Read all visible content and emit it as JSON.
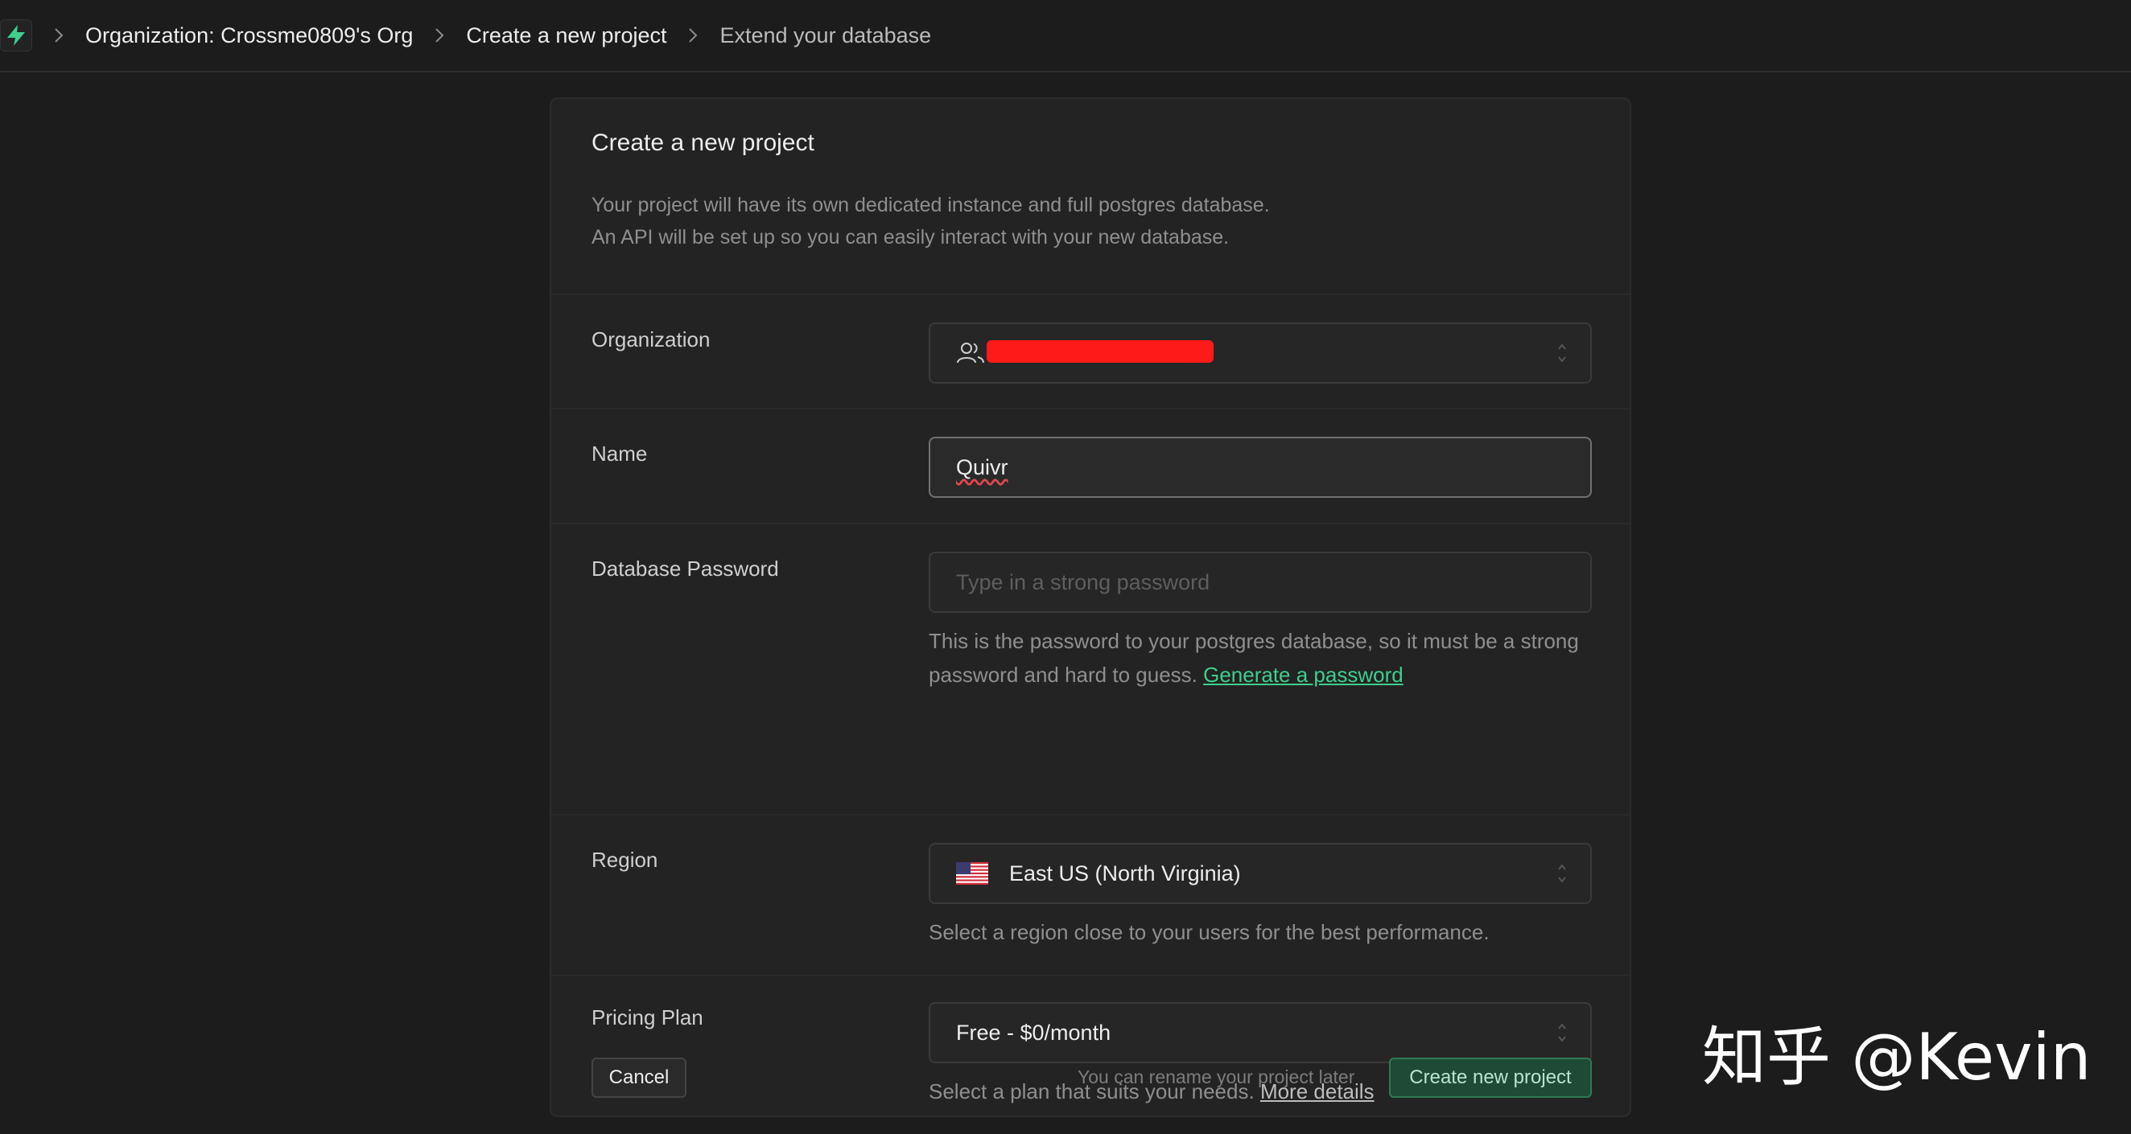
{
  "breadcrumb": {
    "items": [
      "Organization: Crossme0809's Org",
      "Create a new project",
      "Extend your database"
    ]
  },
  "card": {
    "title": "Create a new project",
    "description_line1": "Your project will have its own dedicated instance and full postgres database.",
    "description_line2": "An API will be set up so you can easily interact with your new database."
  },
  "form": {
    "organization": {
      "label": "Organization"
    },
    "name": {
      "label": "Name",
      "value": "Quivr"
    },
    "password": {
      "label": "Database Password",
      "placeholder": "Type in a strong password",
      "helper": "This is the password to your postgres database, so it must be a strong password and hard to guess.",
      "generate_link": "Generate a password"
    },
    "region": {
      "label": "Region",
      "value": "East US (North Virginia)",
      "helper": "Select a region close to your users for the best performance."
    },
    "pricing": {
      "label": "Pricing Plan",
      "value": "Free - $0/month",
      "helper": "Select a plan that suits your needs.",
      "details_link": "More details"
    }
  },
  "footer": {
    "cancel_label": "Cancel",
    "rename_note": "You can rename your project later",
    "create_label": "Create new project"
  },
  "watermark": "知乎 @Kevin",
  "colors": {
    "accent": "#3ecf8e",
    "redaction": "#ff1a1a",
    "background": "#1c1c1c"
  }
}
